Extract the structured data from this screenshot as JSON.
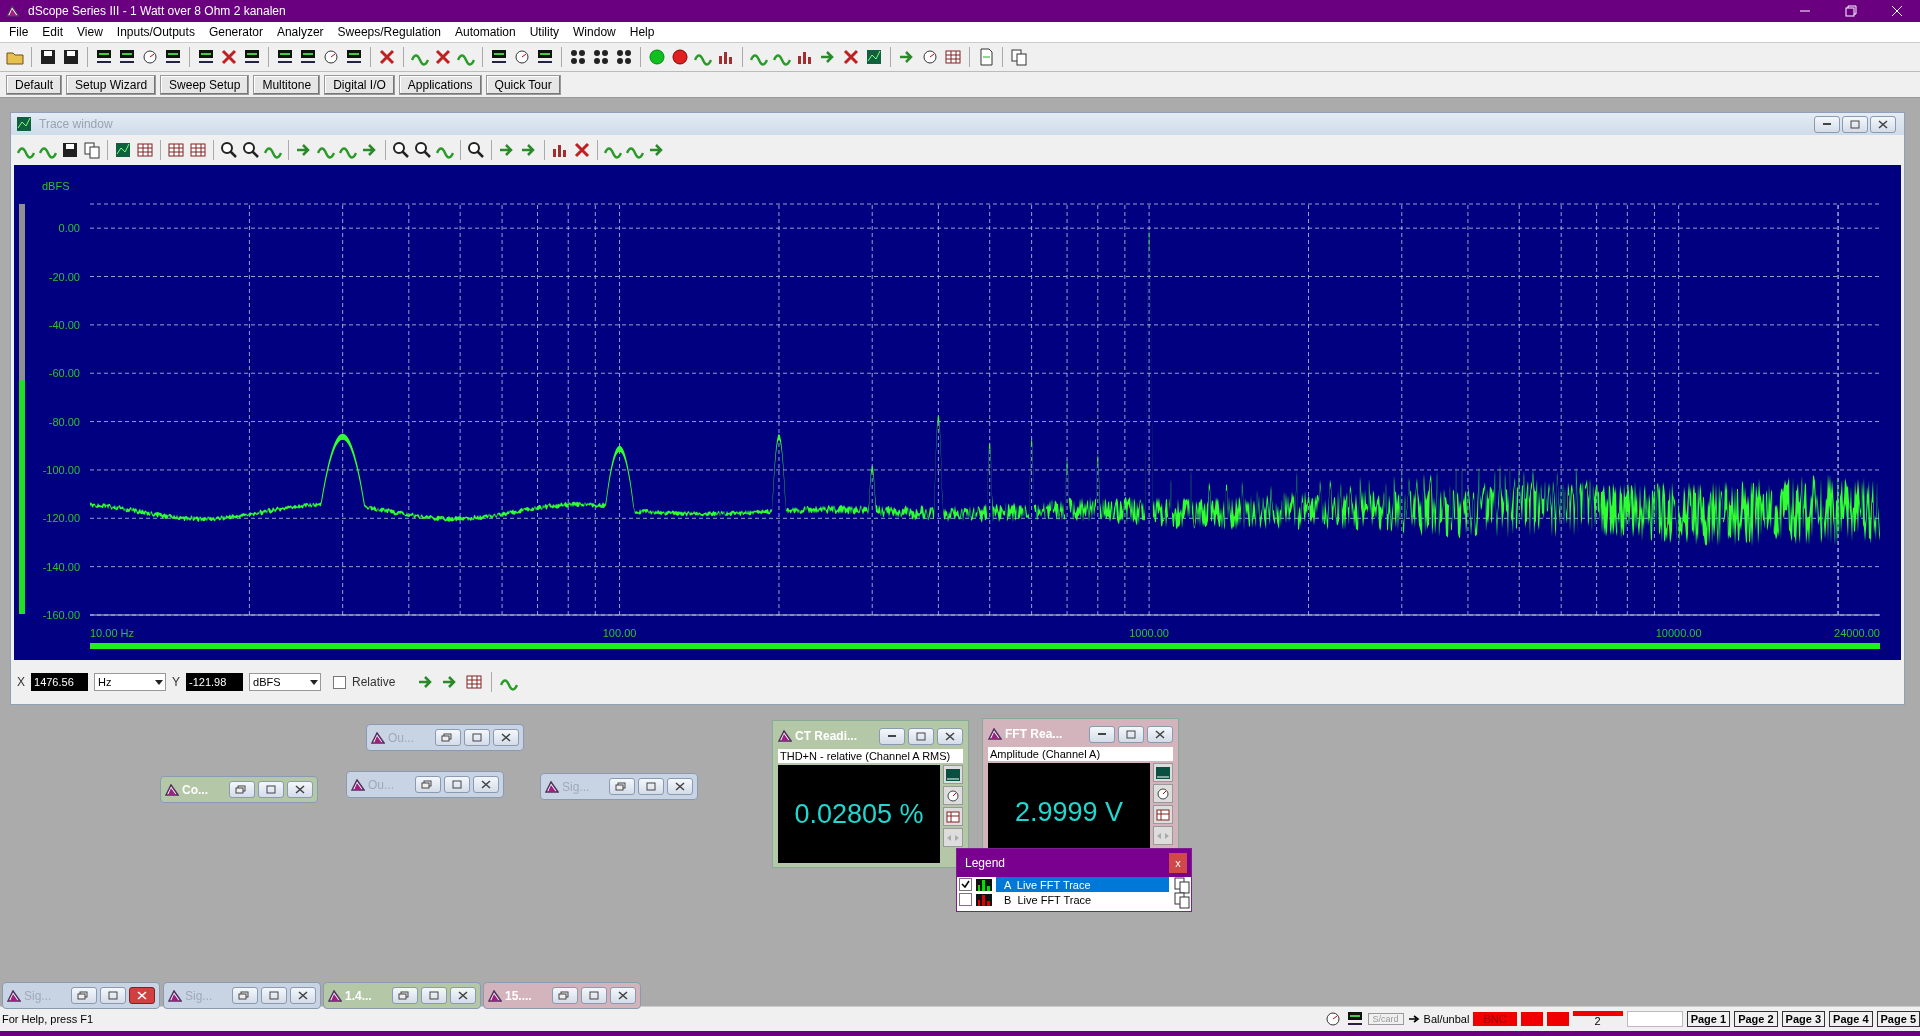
{
  "app": {
    "title": "dScope Series III - 1 Watt over 8 Ohm 2 kanalen"
  },
  "menu": [
    "File",
    "Edit",
    "View",
    "Inputs/Outputs",
    "Generator",
    "Analyzer",
    "Sweeps/Regulation",
    "Automation",
    "Utility",
    "Window",
    "Help"
  ],
  "quick_buttons": [
    "Default",
    "Setup Wizard",
    "Sweep Setup",
    "Multitone",
    "Digital I/O",
    "Applications",
    "Quick Tour"
  ],
  "trace_window": {
    "title": "Trace window",
    "plot": {
      "ylabel": "dBFS",
      "y_labels": [
        "0.00",
        "-20.00",
        "-40.00",
        "-60.00",
        "-80.00",
        "-100.00",
        "-120.00",
        "-140.00",
        "-160.00"
      ],
      "x_labels": [
        "10.00 Hz",
        "100.00",
        "1000.00",
        "10000.00",
        "24000.00"
      ]
    },
    "input_meter": {
      "level": 0.57
    },
    "cursor": {
      "x_label": "X",
      "x_value": "1476.56",
      "x_unit": "Hz",
      "y_label": "Y",
      "y_value": "-121.98",
      "y_unit": "dBFS",
      "relative_label": "Relative",
      "relative_checked": false
    }
  },
  "minimized_windows": [
    {
      "title": "Ou...",
      "color": "#c8d4e4",
      "close_highlighted": false
    },
    {
      "title": "Co...",
      "color": "#b4c8a8",
      "close_highlighted": false
    },
    {
      "title": "Ou...",
      "color": "#c8d4e4",
      "close_highlighted": false
    },
    {
      "title": "Sig...",
      "color": "#c8d4e4",
      "close_highlighted": false
    },
    {
      "title": "Sig...",
      "color": "#c8d4e4",
      "close_highlighted": true
    },
    {
      "title": "Sig...",
      "color": "#c8d4e4",
      "close_highlighted": false
    },
    {
      "title": "1.4...",
      "color": "#b4c8a8",
      "close_highlighted": false
    },
    {
      "title": "15....",
      "color": "#d4b4bc",
      "close_highlighted": false
    }
  ],
  "readouts": [
    {
      "title": "CT Readi...",
      "caption": "THD+N - relative (Channel A RMS)",
      "value": "0.02805 %",
      "color": "#b4c8a8"
    },
    {
      "title": "FFT Rea...",
      "caption": "Amplitude (Channel A)",
      "value": "2.9999 V",
      "color": "#d4b4bc"
    }
  ],
  "legend": {
    "title": "Legend",
    "close": "x",
    "items": [
      {
        "label": "A  Live FFT Trace",
        "checked": true,
        "selected": true,
        "color": "#00e000"
      },
      {
        "label": "B  Live FFT Trace",
        "checked": false,
        "selected": false,
        "color": "#e00000"
      }
    ]
  },
  "status_bar": {
    "help": "For Help, press F1",
    "card": "S/card",
    "input": "Bal/unbal",
    "connector": "BNC",
    "channel": "2",
    "pages": [
      "Page 1",
      "Page 2",
      "Page 3",
      "Page 4",
      "Page 5"
    ]
  }
}
